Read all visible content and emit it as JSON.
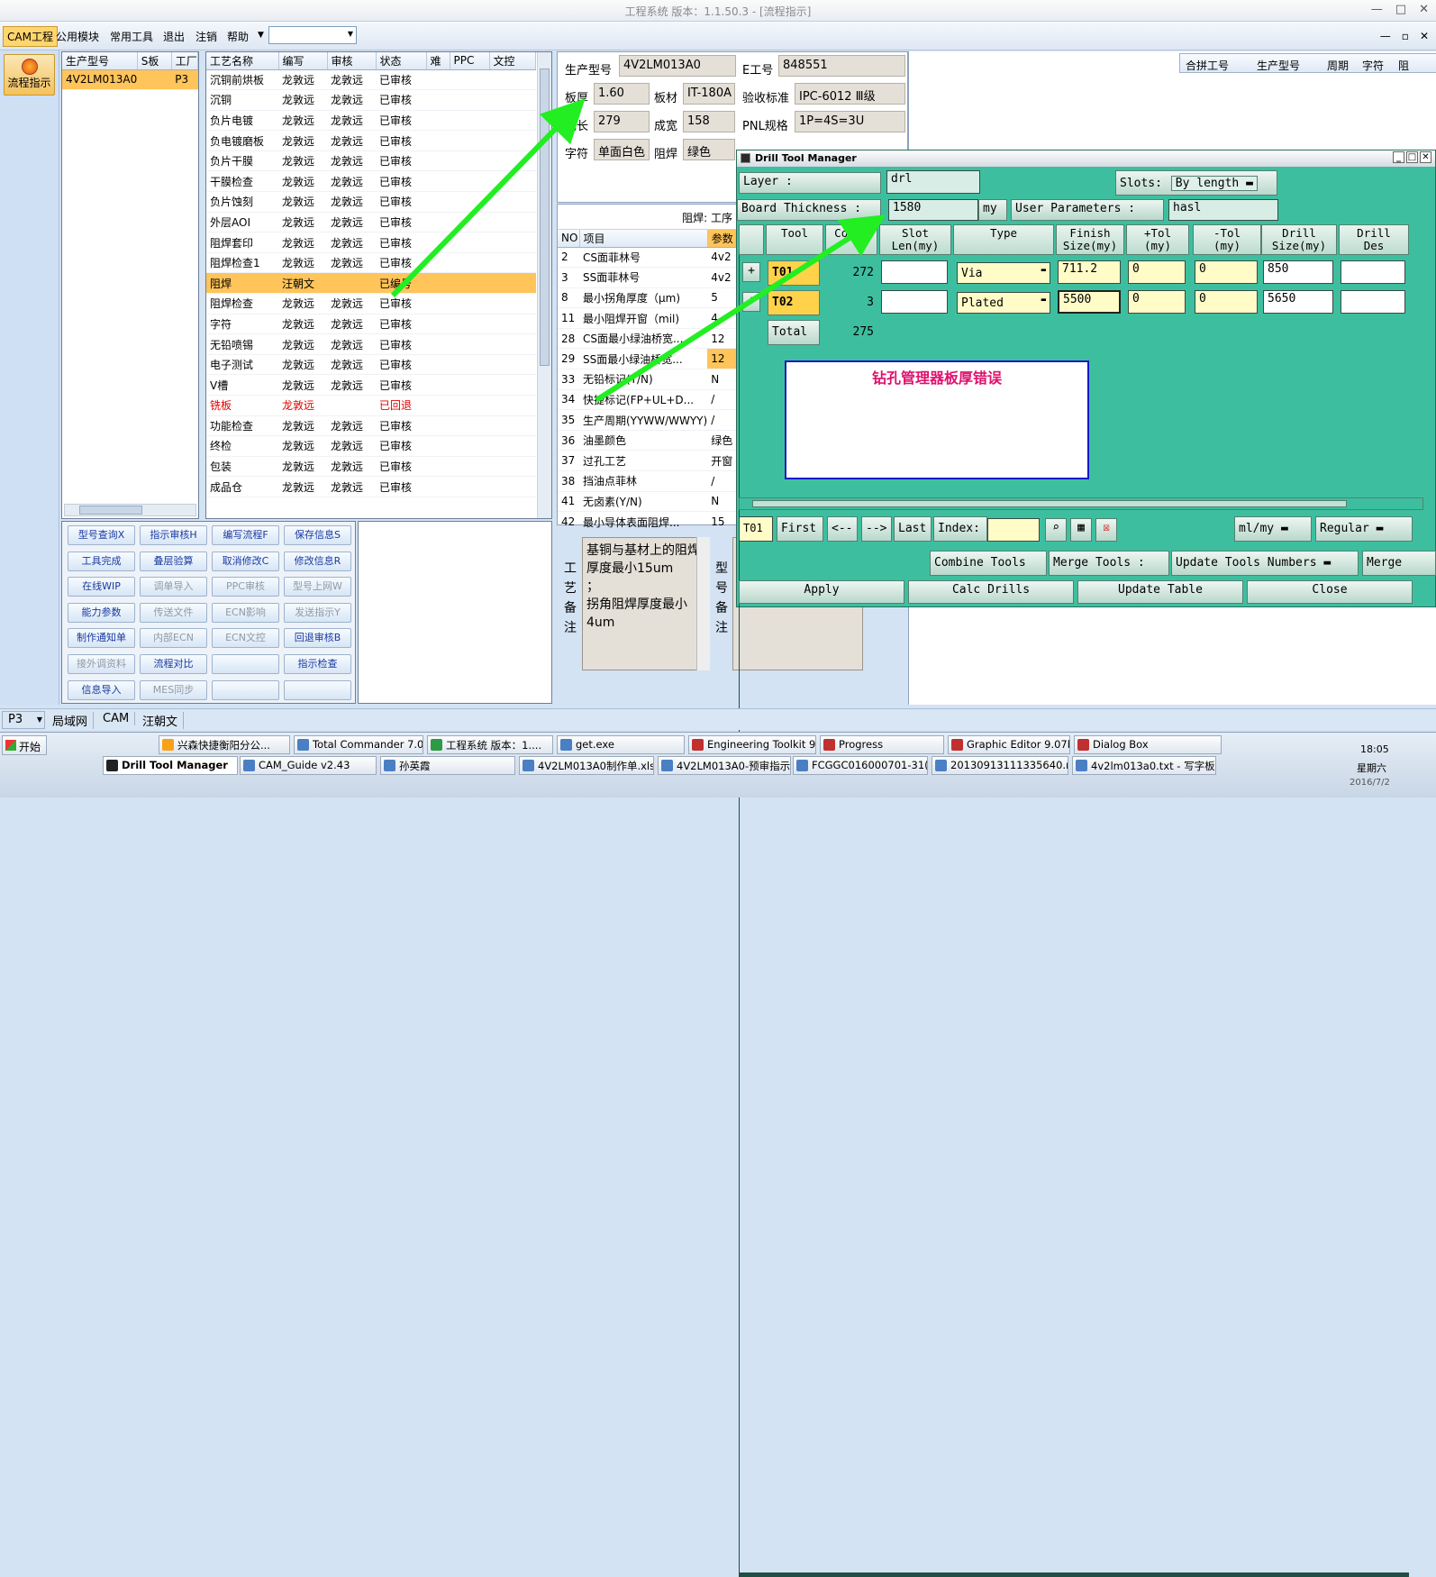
{
  "window": {
    "title": "工程系统  版本：1.1.50.3 - [流程指示]",
    "controls": [
      "—",
      "□",
      "✕"
    ]
  },
  "menu": {
    "cam": "CAM工程",
    "items": [
      "公用模块",
      "常用工具",
      "退出",
      "注销",
      "帮助"
    ],
    "mdi_controls": [
      "—",
      "▫",
      "✕"
    ]
  },
  "left_strip": {
    "flow_label": "流程指示"
  },
  "jobs": {
    "headers": [
      "生产型号",
      "S板",
      "工厂"
    ],
    "rows": [
      {
        "model": "4V2LM013A0",
        "s": "",
        "factory": "P3"
      }
    ]
  },
  "process": {
    "headers": [
      "工艺名称",
      "编写",
      "审核",
      "状态",
      "难",
      "PPC",
      "文控"
    ],
    "rows": [
      [
        "沉铜前烘板",
        "龙敦远",
        "龙敦远",
        "已审核"
      ],
      [
        "沉铜",
        "龙敦远",
        "龙敦远",
        "已审核"
      ],
      [
        "负片电镀",
        "龙敦远",
        "龙敦远",
        "已审核"
      ],
      [
        "负电镀磨板",
        "龙敦远",
        "龙敦远",
        "已审核"
      ],
      [
        "负片干膜",
        "龙敦远",
        "龙敦远",
        "已审核"
      ],
      [
        "干膜检查",
        "龙敦远",
        "龙敦远",
        "已审核"
      ],
      [
        "负片蚀刻",
        "龙敦远",
        "龙敦远",
        "已审核"
      ],
      [
        "外层AOI",
        "龙敦远",
        "龙敦远",
        "已审核"
      ],
      [
        "阻焊套印",
        "龙敦远",
        "龙敦远",
        "已审核"
      ],
      [
        "阻焊检查1",
        "龙敦远",
        "龙敦远",
        "已审核"
      ],
      [
        "阻焊",
        "汪朝文",
        "",
        "已编号"
      ],
      [
        "阻焊检查",
        "龙敦远",
        "龙敦远",
        "已审核"
      ],
      [
        "字符",
        "龙敦远",
        "龙敦远",
        "已审核"
      ],
      [
        "无铅喷锡",
        "龙敦远",
        "龙敦远",
        "已审核"
      ],
      [
        "电子测试",
        "龙敦远",
        "龙敦远",
        "已审核"
      ],
      [
        "V槽",
        "龙敦远",
        "龙敦远",
        "已审核"
      ],
      [
        "铣板",
        "龙敦远",
        "",
        "已回退"
      ],
      [
        "功能检查",
        "龙敦远",
        "龙敦远",
        "已审核"
      ],
      [
        "终检",
        "龙敦远",
        "龙敦远",
        "已审核"
      ],
      [
        "包装",
        "龙敦远",
        "龙敦远",
        "已审核"
      ],
      [
        "成品仓",
        "龙敦远",
        "龙敦远",
        "已审核"
      ]
    ]
  },
  "buttons": [
    [
      "型号查询X",
      "指示审核H",
      "编写流程F",
      "保存信息S"
    ],
    [
      "工具完成",
      "叠层验算",
      "取消修改C",
      "修改信息R"
    ],
    [
      "在线WIP",
      "调单导入",
      "PPC审核",
      "型号上网W"
    ],
    [
      "能力参数",
      "传送文件",
      "ECN影响",
      "发送指示Y"
    ],
    [
      "制作通知单",
      "内部ECN",
      "ECN文控",
      "回退审核B"
    ],
    [
      "接外调资料",
      "流程对比",
      "",
      "指示检查"
    ],
    [
      "信息导入",
      "MES同步",
      "",
      ""
    ]
  ],
  "disabled_buttons": [
    "调单导入",
    "PPC审核",
    "型号上网W",
    "传送文件",
    "ECN影响",
    "发送指示Y",
    "内部ECN",
    "ECN文控",
    "接外调资料",
    "MES同步"
  ],
  "info": {
    "model_label": "生产型号",
    "model": "4V2LM013A0",
    "eno_label": "E工号",
    "eno": "848551",
    "thick_label": "板厚",
    "thick": "1.60",
    "mat_label": "板材",
    "mat": "IT-180A",
    "std_label": "验收标准",
    "std": "IPC-6012 Ⅲ级",
    "len_label": "成长",
    "len": "279",
    "wid_label": "成宽",
    "wid": "158",
    "pnl_label": "PNL规格",
    "pnl": "1P=4S=3U",
    "char_label": "字符",
    "char": "单面白色",
    "mask_label": "阻焊",
    "mask": "绿色"
  },
  "merge_table": {
    "headers": [
      "合拼工号",
      "生产型号",
      "周期",
      "字符",
      "阻"
    ]
  },
  "params": {
    "title": "阻焊: 工序",
    "headers": [
      "NO",
      "项目",
      "参数"
    ],
    "rows": [
      [
        "2",
        "CS面菲林号",
        "4v2"
      ],
      [
        "3",
        "SS面菲林号",
        "4v2"
      ],
      [
        "8",
        "最小拐角厚度（μm)",
        "5"
      ],
      [
        "11",
        "最小阻焊开窗（mil)",
        "4"
      ],
      [
        "28",
        "CS面最小绿油桥宽...",
        "12"
      ],
      [
        "29",
        "SS面最小绿油桥宽...",
        "12"
      ],
      [
        "33",
        "无铅标记(Y/N)",
        "N"
      ],
      [
        "34",
        "快捷标记(FP+UL+D...",
        "/"
      ],
      [
        "35",
        "生产周期(YYWW/WWYY)",
        "/"
      ],
      [
        "36",
        "油墨颜色",
        "绿色"
      ],
      [
        "37",
        "过孔工艺",
        "开窗"
      ],
      [
        "38",
        "挡油点菲林",
        "/"
      ],
      [
        "41",
        "无卤素(Y/N)",
        "N"
      ],
      [
        "42",
        "最小导体表面阻焊...",
        "15"
      ]
    ]
  },
  "remark": {
    "label": "工艺备注",
    "text": "基铜与基材上的阻焊厚度最小15um\n；\n拐角阻焊厚度最小4um",
    "label2": "型号备注"
  },
  "dtm": {
    "title": "Drill Tool Manager",
    "layer_label": "Layer          :",
    "layer": "drl",
    "slots_label": "Slots:",
    "slots": "By length",
    "board_label": "Board Thickness :",
    "board": "1580",
    "unit": "my",
    "user_label": "User Parameters :",
    "user": "hasl",
    "headers": [
      "Tool",
      "Count",
      "Slot\nLen(my)",
      "Type",
      "Finish\nSize(my)",
      "+Tol\n(my)",
      "-Tol\n(my)",
      "Drill\nSize(my)",
      "Drill\nDes"
    ],
    "rows": [
      {
        "tool": "T01",
        "count": "272",
        "slot": "",
        "type": "Via",
        "finish": "711.2",
        "ptol": "0",
        "mtol": "0",
        "drill": "850",
        "des": ""
      },
      {
        "tool": "T02",
        "count": "3",
        "slot": "",
        "type": "Plated",
        "finish": "5500",
        "ptol": "0",
        "mtol": "0",
        "drill": "5650",
        "des": ""
      }
    ],
    "total_label": "Total",
    "total": "275",
    "error": "钻孔管理器板厚错误",
    "nav": {
      "current": "T01",
      "first": "First",
      "prev": "<--",
      "next": "-->",
      "last": "Last",
      "index": "Index:",
      "unit": "ml/my",
      "mode": "Regular"
    },
    "actions": {
      "combine": "Combine Tools",
      "merge_label": "Merge Tools :",
      "update_numbers": "Update Tools Numbers",
      "merge": "Merge"
    },
    "bottom": [
      "Apply",
      "Calc Drills",
      "Update Table",
      "Close"
    ]
  },
  "status": {
    "combo": "P3",
    "items": [
      "局域网",
      "CAM",
      "汪朝文"
    ]
  },
  "taskbar": {
    "start": "开始",
    "row1": [
      "兴森快捷衡阳分公...",
      "Total Commander 7.0 ...",
      "工程系统  版本：1....",
      "get.exe",
      "Engineering Toolkit 9....",
      "Progress",
      "Graphic Editor 9.07b2...",
      "Dialog Box"
    ],
    "row2": [
      "Drill Tool Manager",
      "CAM_Guide v2.43",
      "孙英霞",
      "4V2LM013A0制作单.xls...",
      "4V2LM013A0-预审指示...",
      "FCGGC016000701-31(4...",
      "20130913111335640.rt...",
      "4v2lm013a0.txt - 写字板"
    ],
    "time": "18:05",
    "day": "星期六",
    "date": "2016/7/2"
  },
  "colors": {
    "accent": "#ffc45a",
    "dtm_bg": "#3dbf9f",
    "error_text": "#e0106e",
    "arrow": "#22ee22"
  }
}
